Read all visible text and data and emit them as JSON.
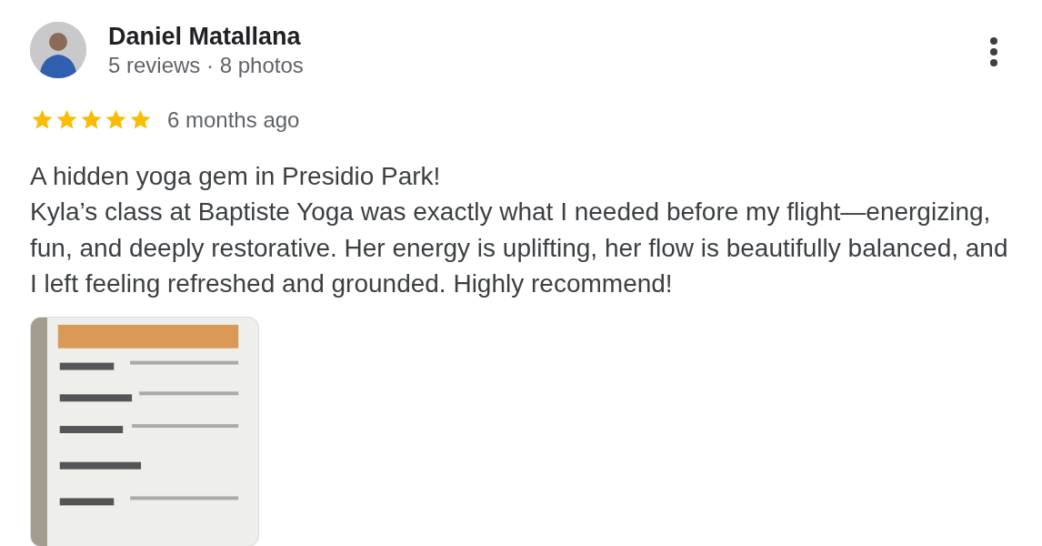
{
  "reviewer": {
    "name": "Daniel Matallana",
    "stats": "5 reviews · 8 photos"
  },
  "rating": {
    "stars": 5,
    "time": "6 months ago"
  },
  "review": {
    "headline": "A hidden yoga gem in Presidio Park!",
    "body": "Kyla’s class at Baptiste Yoga was exactly what I needed before my flight—energizing, fun, and deeply restorative. Her energy is uplifting, her flow is beautifully balanced, and I left feeling refreshed and grounded. Highly recommend!"
  }
}
